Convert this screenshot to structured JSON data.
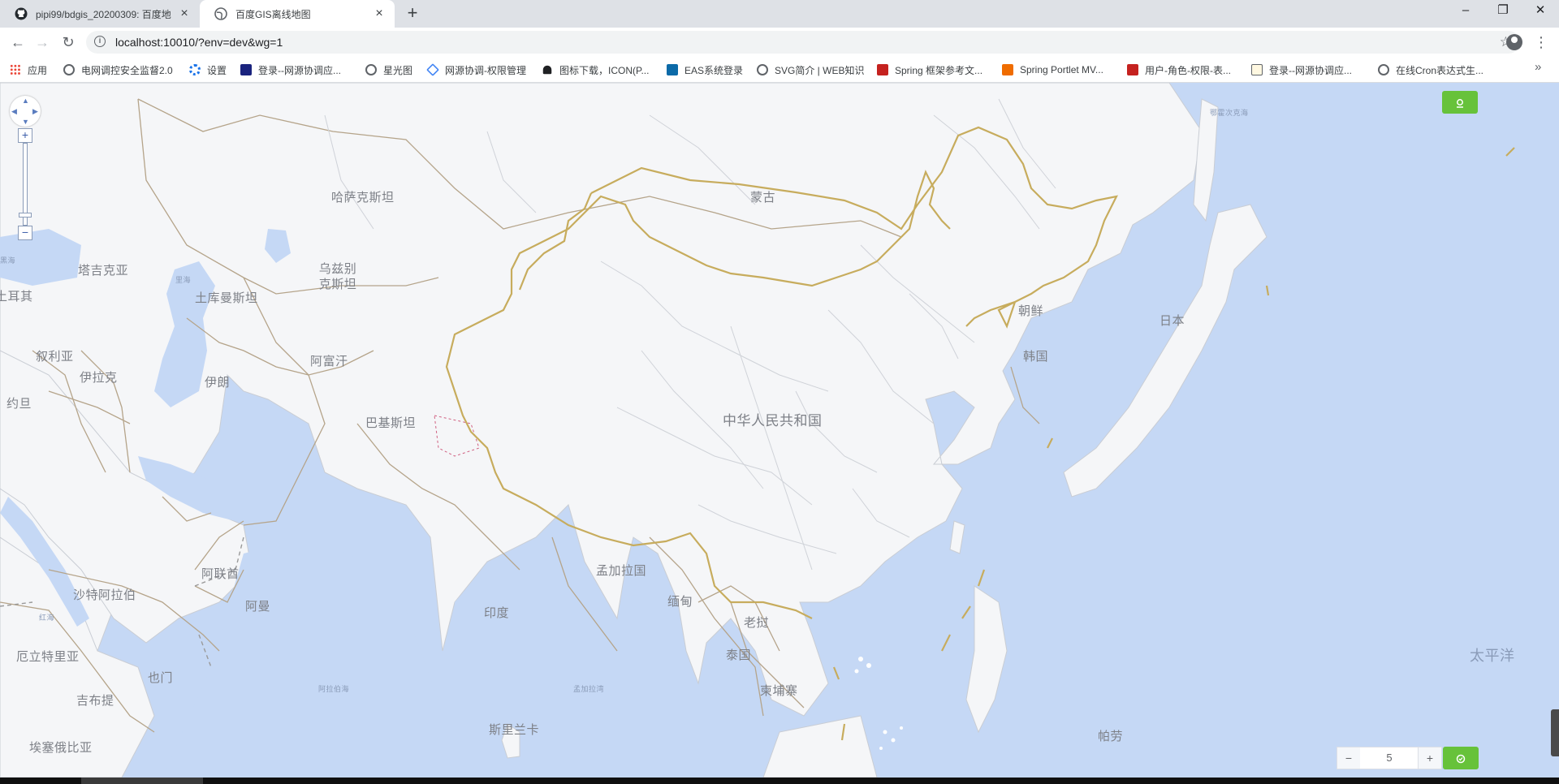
{
  "browser": {
    "tabs": [
      {
        "title": "pipi99/bdgis_20200309: 百度地",
        "icon": "github-icon"
      },
      {
        "title": "百度GIS离线地图",
        "icon": "globe-icon"
      }
    ],
    "url": "localhost:10010/?env=dev&wg=1",
    "bookmarks": [
      {
        "label": "应用",
        "icon": "apps-grid-icon"
      },
      {
        "label": "电网调控安全监督2.0",
        "icon": "globe-icon"
      },
      {
        "label": "设置",
        "icon": "gear-icon"
      },
      {
        "label": "登录--网源协调应...",
        "icon": "red-app-icon"
      },
      {
        "label": "星光图",
        "icon": "globe-icon"
      },
      {
        "label": "网源协调-权限管理",
        "icon": "diamond-icon"
      },
      {
        "label": "图标下载，ICON(P...",
        "icon": "person-icon"
      },
      {
        "label": "EAS系统登录",
        "icon": "eas-icon"
      },
      {
        "label": "SVG简介 | WEB知识",
        "icon": "globe-icon"
      },
      {
        "label": "Spring 框架参考文...",
        "icon": "red-c-icon"
      },
      {
        "label": "Spring Portlet MV...",
        "icon": "orange-s-icon"
      },
      {
        "label": "用户-角色-权限-表...",
        "icon": "red-c-icon"
      },
      {
        "label": "登录--网源协调应...",
        "icon": "image-icon"
      },
      {
        "label": "在线Cron表达式生...",
        "icon": "globe-icon"
      }
    ],
    "more": "»"
  },
  "map": {
    "labels": {
      "kazakhstan": "哈萨克斯坦",
      "mongolia": "蒙古",
      "uzbekistan": "乌兹别克斯坦",
      "turkmenistan": "土库曼斯坦",
      "azerbaijan": "塔吉克亚",
      "turkey": "土耳其",
      "syria": "叙利亚",
      "iraq": "伊拉克",
      "iran": "伊朗",
      "afghanistan": "阿富汗",
      "pakistan": "巴基斯坦",
      "jordan": "约旦",
      "china": "中华人民共和国",
      "north_korea": "朝鲜",
      "south_korea": "韩国",
      "japan": "日本",
      "uae": "阿联酋",
      "saudi": "沙特阿拉伯",
      "oman": "阿曼",
      "bangladesh": "孟加拉国",
      "myanmar": "缅甸",
      "india": "印度",
      "laos": "老挝",
      "thailand": "泰国",
      "cambodia": "柬埔寨",
      "eritrea": "厄立特里亚",
      "yemen": "也门",
      "djibouti": "吉布提",
      "ethiopia": "埃塞俄比亚",
      "sri_lanka": "斯里兰卡",
      "palau": "帕劳",
      "pacific": "太平洋",
      "okhotsk": "鄂霍次克海",
      "caspian": "里海",
      "red_sea": "红海",
      "black_sea": "黑海",
      "arabian_sea": "阿拉伯海",
      "bay_of_bengal": "孟加拉湾"
    },
    "controls": {
      "zoom_in": "+",
      "zoom_out": "−",
      "zoom_level": "5",
      "minus": "−",
      "plus": "+"
    }
  }
}
